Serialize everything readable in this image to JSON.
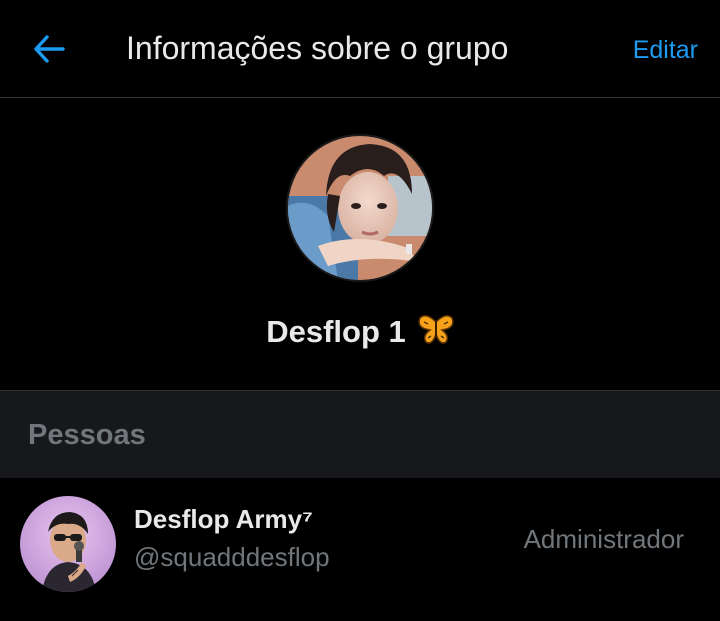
{
  "header": {
    "back_icon": "arrow-left-icon",
    "title": "Informações sobre o grupo",
    "edit_label": "Editar"
  },
  "group": {
    "name": "Desflop 1",
    "emoji_icon": "butterfly-icon"
  },
  "people_section": {
    "title": "Pessoas",
    "members": [
      {
        "display_name": "Desflop Army⁷",
        "handle": "@squadddesflop",
        "role": "Administrador"
      }
    ]
  },
  "colors": {
    "background": "#000000",
    "accent": "#1d9bf0",
    "text_primary": "#e7e9ea",
    "text_secondary": "#71767b",
    "section_bg": "#16181c",
    "divider": "#2f3336"
  }
}
